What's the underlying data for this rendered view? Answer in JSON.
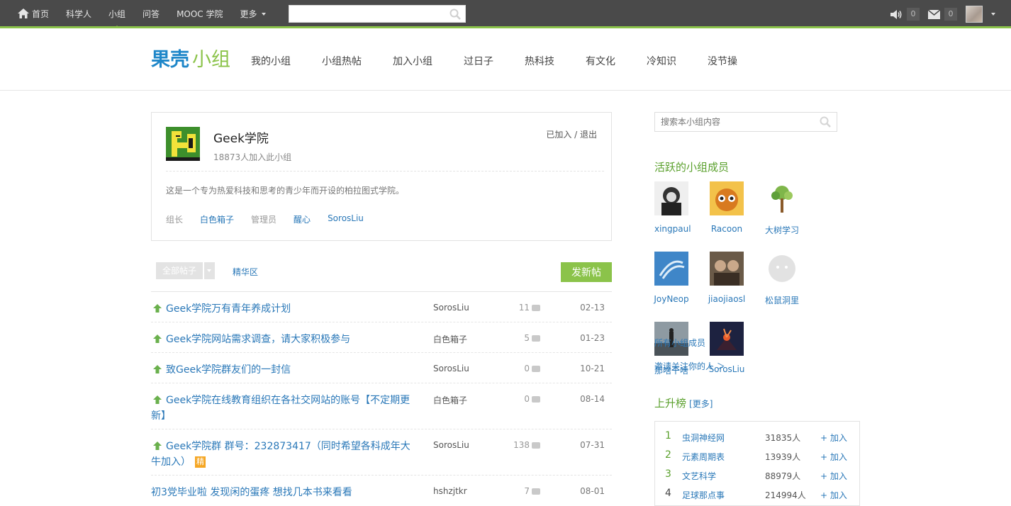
{
  "topbar": {
    "home": "首页",
    "nav": [
      "科学人",
      "小组",
      "问答",
      "MOOC 学院",
      "更多"
    ],
    "search_placeholder": "",
    "sound_count": "0",
    "mail_count": "0"
  },
  "header": {
    "logo_brand": "果壳",
    "logo_product": "小组",
    "nav": [
      "我的小组",
      "小组热帖",
      "加入小组",
      "过日子",
      "热科技",
      "有文化",
      "冷知识",
      "没节操"
    ]
  },
  "group": {
    "name": "Geek学院",
    "member_count": "18873人加入此小组",
    "join_status": "已加入 / 退出",
    "description": "这是一个专为热爱科技和思考的青少年而开设的柏拉图式学院。",
    "leader_label": "组长",
    "leader": "白色箱子",
    "admin_label": "管理员",
    "admins": [
      "醒心",
      "SorosLiu"
    ]
  },
  "toolbar": {
    "filter": "全部帖子",
    "elite": "精华区",
    "new_post": "发新帖"
  },
  "posts": [
    {
      "title": "Geek学院万有青年养成计划",
      "author": "SorosLiu",
      "replies": "11",
      "date": "02-13",
      "pinned": true
    },
    {
      "title": "Geek学院网站需求调查，请大家积极参与",
      "author": "白色箱子",
      "replies": "5",
      "date": "01-23",
      "pinned": true
    },
    {
      "title": "致Geek学院群友们的一封信",
      "author": "SorosLiu",
      "replies": "0",
      "date": "10-21",
      "pinned": true
    },
    {
      "title": "Geek学院在线教育组织在各社交网站的账号【不定期更新】",
      "author": "白色箱子",
      "replies": "0",
      "date": "08-14",
      "pinned": true
    },
    {
      "title": "Geek学院群 群号：232873417（同时希望各科成年大牛加入）",
      "author": "SorosLiu",
      "replies": "138",
      "date": "07-31",
      "pinned": true,
      "badge": "精"
    },
    {
      "title": "初3党毕业啦 发现闲的蛋疼 想找几本书来看看",
      "author": "hshzjtkr",
      "replies": "7",
      "date": "08-01",
      "pinned": false
    }
  ],
  "sidebar": {
    "search_placeholder": "搜索本小组内容",
    "active_members_title": "活跃的小组成员",
    "members": [
      {
        "name": "xingpaul",
        "color": "#2b2b2b"
      },
      {
        "name": "Racoon",
        "color": "#e8a23a"
      },
      {
        "name": "大树学习",
        "color": "#7fb64a"
      },
      {
        "name": "JoyNeop",
        "color": "#3f86c8"
      },
      {
        "name": "jiaojiaosl",
        "color": "#5a4a3a"
      },
      {
        "name": "松鼠洞里",
        "color": "#d9d9d9"
      },
      {
        "name": "那啥干啥",
        "color": "#54606a"
      },
      {
        "name": "SorosLiu",
        "color": "#1d2240"
      }
    ],
    "all_members": "所有小组成员",
    "invite": "邀请关注你的人 ＞",
    "rising_title": "上升榜",
    "rising_more": "[更多]",
    "rising": [
      {
        "rank": "1",
        "name": "虫洞神经网",
        "count": "31835人",
        "action": "+ 加入"
      },
      {
        "rank": "2",
        "name": "元素周期表",
        "count": "13939人",
        "action": "+ 加入"
      },
      {
        "rank": "3",
        "name": "文艺科学",
        "count": "88979人",
        "action": "+ 加入"
      },
      {
        "rank": "4",
        "name": "足球那点事",
        "count": "214994人",
        "action": "+ 加入"
      }
    ]
  },
  "colors": {
    "accent": "#8bc34a",
    "link": "#2a78b8",
    "topbar": "#4a4a4a"
  }
}
